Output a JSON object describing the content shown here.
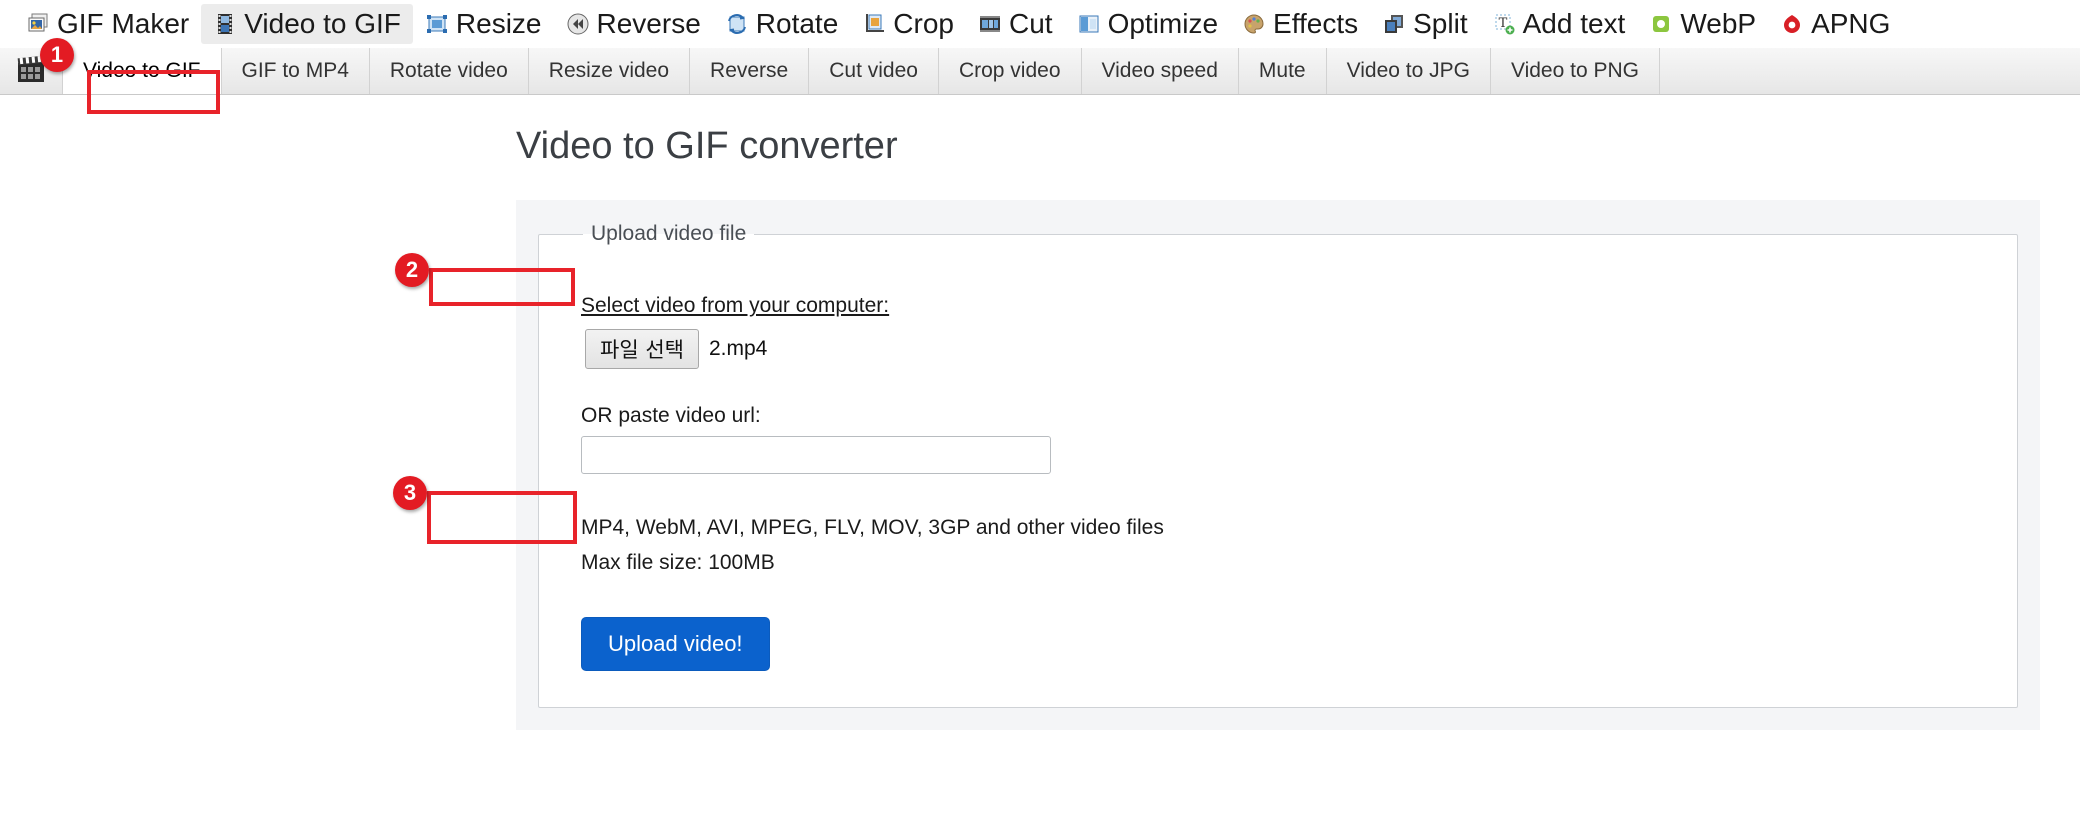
{
  "topnav": {
    "items": [
      {
        "label": "GIF Maker",
        "icon": "gif-maker-icon",
        "active": false
      },
      {
        "label": "Video to GIF",
        "icon": "film-strip-icon",
        "active": true
      },
      {
        "label": "Resize",
        "icon": "resize-icon",
        "active": false
      },
      {
        "label": "Reverse",
        "icon": "reverse-icon",
        "active": false
      },
      {
        "label": "Rotate",
        "icon": "rotate-icon",
        "active": false
      },
      {
        "label": "Crop",
        "icon": "crop-icon",
        "active": false
      },
      {
        "label": "Cut",
        "icon": "cut-icon",
        "active": false
      },
      {
        "label": "Optimize",
        "icon": "optimize-icon",
        "active": false
      },
      {
        "label": "Effects",
        "icon": "effects-palette-icon",
        "active": false
      },
      {
        "label": "Split",
        "icon": "split-icon",
        "active": false
      },
      {
        "label": "Add text",
        "icon": "add-text-icon",
        "active": false
      },
      {
        "label": "WebP",
        "icon": "webp-icon",
        "active": false
      },
      {
        "label": "APNG",
        "icon": "apng-icon",
        "active": false
      }
    ]
  },
  "subnav": {
    "logo_icon": "clapperboard-icon",
    "items": [
      {
        "label": "Video to GIF",
        "active": true
      },
      {
        "label": "GIF to MP4",
        "active": false
      },
      {
        "label": "Rotate video",
        "active": false
      },
      {
        "label": "Resize video",
        "active": false
      },
      {
        "label": "Reverse",
        "active": false
      },
      {
        "label": "Cut video",
        "active": false
      },
      {
        "label": "Crop video",
        "active": false
      },
      {
        "label": "Video speed",
        "active": false
      },
      {
        "label": "Mute",
        "active": false
      },
      {
        "label": "Video to JPG",
        "active": false
      },
      {
        "label": "Video to PNG",
        "active": false
      }
    ]
  },
  "main": {
    "title": "Video to GIF converter",
    "fieldset_legend": "Upload video file",
    "select_label": "Select video from your computer:",
    "file_button_label": "파일 선택",
    "file_name": "2.mp4",
    "url_label": "OR paste video url:",
    "url_value": "",
    "url_placeholder": "",
    "formats_text": "MP4, WebM, AVI, MPEG, FLV, MOV, 3GP and other video files",
    "max_size_text": "Max file size: 100MB",
    "upload_button_label": "Upload video!"
  },
  "annotations": {
    "badges": [
      {
        "number": "1"
      },
      {
        "number": "2"
      },
      {
        "number": "3"
      }
    ],
    "color": "#e31b23"
  },
  "colors": {
    "accent_blue": "#0b62cd",
    "annotation_red": "#e31b23",
    "panel_bg": "#f4f5f7",
    "subnav_bg": "#ededed"
  }
}
